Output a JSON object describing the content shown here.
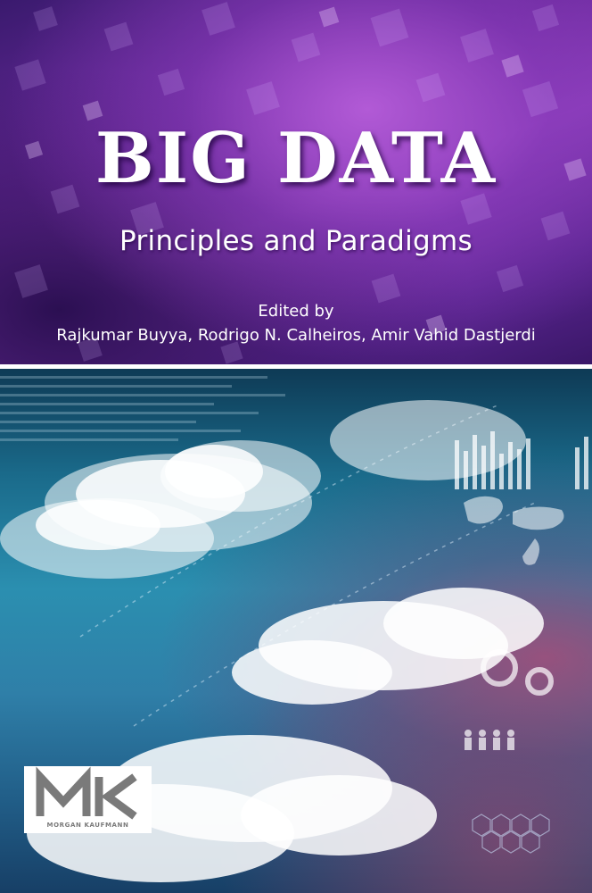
{
  "cover": {
    "title": "BIG DATA",
    "subtitle": "Principles and Paradigms",
    "edited_by": "Edited by",
    "editors": "Rajkumar Buyya, Rodrigo N. Calheiros, Amir Vahid Dastjerdi"
  },
  "publisher": {
    "logo_letters": "MK",
    "name": "MORGAN KAUFMANN"
  },
  "colors": {
    "purple_panel": "#6a2a9c",
    "sky_panel": "#2b8fb0",
    "logo_grey": "#7a7a7a"
  }
}
